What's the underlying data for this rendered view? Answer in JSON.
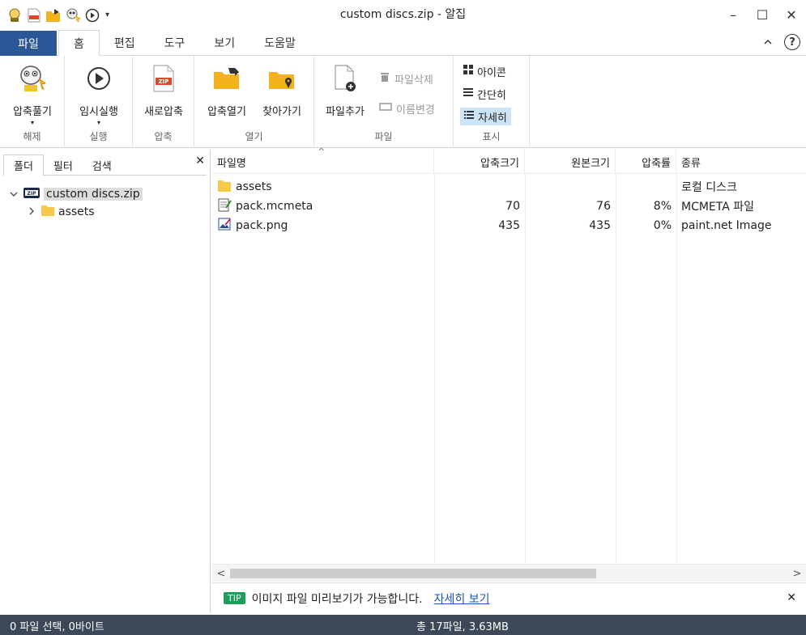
{
  "window": {
    "title": "custom discs.zip - 알집",
    "minimize": "–",
    "maximize": "☐",
    "close": "✕"
  },
  "qat": {
    "dropdown": "▾"
  },
  "menu": {
    "file": "파일",
    "tabs": [
      "홈",
      "편집",
      "도구",
      "보기",
      "도움말"
    ],
    "collapse": "ᨈ",
    "help": "?"
  },
  "ribbon": {
    "groups": {
      "extract": {
        "label": "해제",
        "button": "압축풀기"
      },
      "run": {
        "label": "실행",
        "button": "임시실행"
      },
      "compress": {
        "label": "압축",
        "button": "새로압축"
      },
      "open": {
        "label": "열기",
        "buttons": [
          "압축열기",
          "찾아가기"
        ]
      },
      "file": {
        "label": "파일",
        "add": "파일추가",
        "delete": "파일삭제",
        "rename": "이름변경"
      },
      "view": {
        "label": "표시",
        "icons": "아이콘",
        "brief": "간단히",
        "detail": "자세히"
      }
    }
  },
  "left_panel": {
    "tabs": [
      "폴더",
      "필터",
      "검색"
    ],
    "close": "✕",
    "tree": {
      "root": "custom discs.zip",
      "child": "assets"
    }
  },
  "list": {
    "columns": {
      "name": "파일명",
      "packed": "압축크기",
      "size": "원본크기",
      "ratio": "압축률",
      "type": "종류"
    },
    "sort_indicator": "^",
    "rows": [
      {
        "name": "assets",
        "packed": "",
        "size": "",
        "ratio": "",
        "type": "로컬 디스크",
        "icon": "folder-icon"
      },
      {
        "name": "pack.mcmeta",
        "packed": "70",
        "size": "76",
        "ratio": "8%",
        "type": "MCMETA 파일",
        "icon": "text-file-icon"
      },
      {
        "name": "pack.png",
        "packed": "435",
        "size": "435",
        "ratio": "0%",
        "type": "paint.net Image",
        "icon": "image-file-icon"
      }
    ]
  },
  "scroll": {
    "left": "<",
    "right": ">"
  },
  "tip": {
    "badge": "TIP",
    "text": "이미지 파일 미리보기가 가능합니다.",
    "link": "자세히 보기",
    "close": "✕"
  },
  "status": {
    "left": "0 파일 선택,  0바이트",
    "center": "총 17파일,  3.63MB"
  },
  "colors": {
    "file_tab": "#2b5797",
    "status_bar": "#3c4857",
    "selected": "#cce4f7",
    "folder": "#f7c948",
    "tip_badge": "#1e9e5a"
  }
}
